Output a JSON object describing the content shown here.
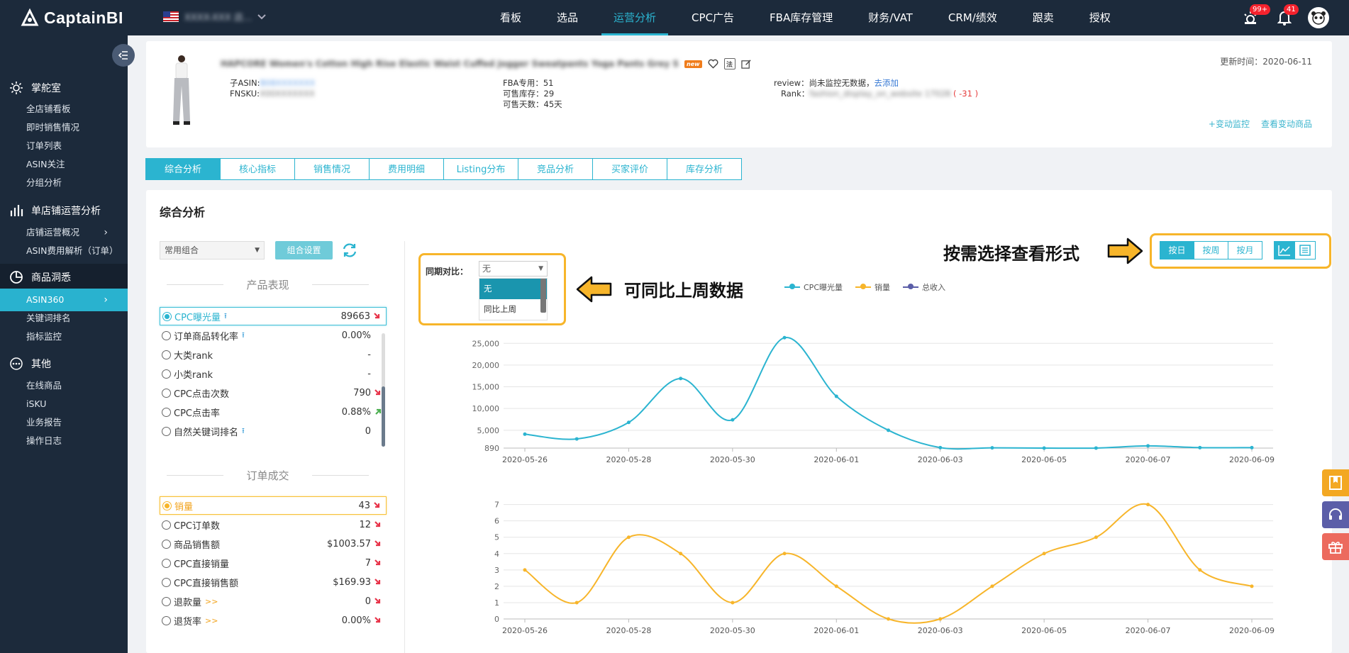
{
  "topbar": {
    "logo_main": "Captain",
    "logo_accent": "BI",
    "store_name": "XXXX-XXX 店...",
    "nav": [
      "看板",
      "选品",
      "运营分析",
      "CPC广告",
      "FBA库存管理",
      "财务/VAT",
      "CRM/绩效",
      "跟卖",
      "授权"
    ],
    "active_nav_index": 2,
    "badge_alerts": "99+",
    "badge_notices": "41"
  },
  "sidebar": {
    "groups": [
      {
        "label": "掌舵室",
        "icon": "gear-icon",
        "items": [
          "全店铺看板",
          "即时销售情况",
          "订单列表",
          "ASIN关注",
          "分组分析"
        ]
      },
      {
        "label": "单店铺运营分析",
        "icon": "bar-chart-icon",
        "items": [
          "店铺运营概况",
          "ASIN费用解析（订单）"
        ]
      },
      {
        "label": "商品洞悉",
        "icon": "pie-chart-icon",
        "items": [
          "ASIN360",
          "关键词排名",
          "指标监控"
        ]
      },
      {
        "label": "其他",
        "icon": "more-icon",
        "items": [
          "在线商品",
          "iSKU",
          "业务报告",
          "操作日志"
        ]
      }
    ],
    "active_item": "ASIN360"
  },
  "product": {
    "title": "HAPCORE Women's Cotton High Rise Elastic Waist Cuffed Jogger Sweatpants Yoga Pants Grey S",
    "new_tag": "new",
    "child_asin_label": "子ASIN:",
    "child_asin_value": "B08XXXXXXX",
    "fnsku_label": "FNSKU:",
    "fnsku_value": "X00XXXXXXX",
    "fba_line": "FBA专用：51",
    "stock_line": "可售库存：29",
    "days_line": "可售天数：45天",
    "review_label": "review：尚未监控无数据，",
    "review_link": "去添加",
    "rank_label": "Rank：",
    "rank_value": "fashion_display_on_website 17028",
    "rank_delta": "( -31 )",
    "update_time": "更新时间：2020-06-11",
    "link_monitor": "+变动监控",
    "link_view": "查看变动商品"
  },
  "tabs": [
    "综合分析",
    "核心指标",
    "销售情况",
    "费用明细",
    "Listing分布",
    "竞品分析",
    "买家评价",
    "库存分析"
  ],
  "analysis": {
    "title": "综合分析",
    "combo_select": "常用组合",
    "combo_button": "组合设置",
    "section_product": "产品表现",
    "section_order": "订单成交",
    "product_metrics": [
      {
        "label": "CPC曝光量",
        "value": "89663",
        "trend": "down",
        "upload": true,
        "selected": true
      },
      {
        "label": "订单商品转化率",
        "value": "0.00%",
        "trend": "",
        "upload": true
      },
      {
        "label": "大类rank",
        "value": "-",
        "trend": ""
      },
      {
        "label": "小类rank",
        "value": "-",
        "trend": ""
      },
      {
        "label": "CPC点击次数",
        "value": "790",
        "trend": "down"
      },
      {
        "label": "CPC点击率",
        "value": "0.88%",
        "trend": "up"
      },
      {
        "label": "自然关键词排名",
        "value": "0",
        "trend": "",
        "upload": true
      }
    ],
    "order_metrics": [
      {
        "label": "销量",
        "value": "43",
        "trend": "down",
        "selected": true
      },
      {
        "label": "CPC订单数",
        "value": "12",
        "trend": "down"
      },
      {
        "label": "商品销售额",
        "value": "$1003.57",
        "trend": "down"
      },
      {
        "label": "CPC直接销量",
        "value": "7",
        "trend": "down"
      },
      {
        "label": "CPC直接销售额",
        "value": "$169.93",
        "trend": "down"
      },
      {
        "label": "退款量",
        "value": "0",
        "trend": "down",
        "more": ">>"
      },
      {
        "label": "退货率",
        "value": "0.00%",
        "trend": "down",
        "more": ">>"
      }
    ],
    "compare_label": "同期对比：",
    "compare_value": "无",
    "compare_options": [
      "无",
      "同比上周"
    ],
    "callout_compare": "可同比上周数据",
    "callout_view": "按需选择查看形式",
    "period_buttons": [
      "按日",
      "按周",
      "按月"
    ],
    "period_active": 0
  },
  "colors": {
    "cyan": "#2bb4d0",
    "yellow": "#f7b52a",
    "navy": "#1c2a3b",
    "purple": "#5b5ea8"
  },
  "chart_data": [
    {
      "type": "line",
      "x": [
        "2020-05-26",
        "2020-05-27",
        "2020-05-28",
        "2020-05-29",
        "2020-05-30",
        "2020-05-31",
        "2020-06-01",
        "2020-06-02",
        "2020-06-03",
        "2020-06-04",
        "2020-06-05",
        "2020-06-06",
        "2020-06-07",
        "2020-06-08",
        "2020-06-09"
      ],
      "x_tick_labels": [
        "2020-05-26",
        "2020-05-28",
        "2020-05-30",
        "2020-06-01",
        "2020-06-03",
        "2020-06-05",
        "2020-06-07",
        "2020-06-09"
      ],
      "series": [
        {
          "name": "CPC曝光量",
          "color": "#2bb4d0",
          "values": [
            4100,
            3000,
            6800,
            16900,
            7400,
            26300,
            12800,
            5000,
            1000,
            950,
            700,
            900,
            1400,
            1000,
            1000
          ]
        }
      ],
      "y_tick_labels": [
        "890",
        "5,000",
        "10,000",
        "15,000",
        "20,000",
        "25,000"
      ],
      "ylim": [
        890,
        27000
      ],
      "legend": [
        "CPC曝光量",
        "销量",
        "总收入"
      ]
    },
    {
      "type": "line",
      "x": [
        "2020-05-26",
        "2020-05-27",
        "2020-05-28",
        "2020-05-29",
        "2020-05-30",
        "2020-05-31",
        "2020-06-01",
        "2020-06-02",
        "2020-06-03",
        "2020-06-04",
        "2020-06-05",
        "2020-06-06",
        "2020-06-07",
        "2020-06-08",
        "2020-06-09"
      ],
      "x_tick_labels": [
        "2020-05-26",
        "2020-05-28",
        "2020-05-30",
        "2020-06-01",
        "2020-06-03",
        "2020-06-05",
        "2020-06-07",
        "2020-06-09"
      ],
      "series": [
        {
          "name": "销量",
          "color": "#f7b52a",
          "values": [
            3,
            1,
            5,
            4,
            1,
            4,
            2,
            0,
            0,
            2,
            4,
            5,
            7,
            3,
            2
          ]
        }
      ],
      "y_tick_labels": [
        "0",
        "1",
        "2",
        "3",
        "4",
        "5",
        "6",
        "7"
      ],
      "ylim": [
        0,
        7
      ]
    }
  ]
}
